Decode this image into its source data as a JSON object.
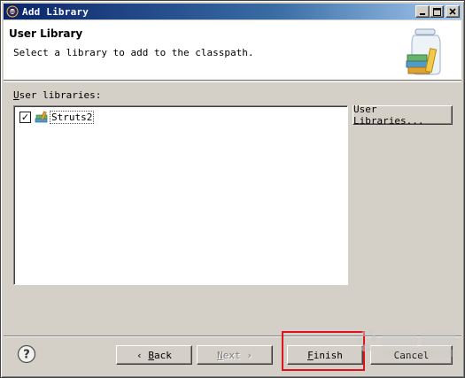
{
  "window": {
    "title": "Add Library",
    "minimize_icon": "minimize-icon",
    "maximize_icon": "maximize-icon",
    "close_icon": "close-icon"
  },
  "header": {
    "title": "User Library",
    "description": "Select a library to add to the classpath.",
    "icon": "library-jar-icon"
  },
  "libraries": {
    "label_first": "U",
    "label_rest": "ser libraries:",
    "items": [
      {
        "label": "Struts2",
        "checked": true,
        "icon": "library-books-icon"
      }
    ],
    "check_glyph": "✓"
  },
  "buttons": {
    "user_libraries": "User Libraries...",
    "back_arrow": "‹",
    "back_first": "B",
    "back_rest": "ack",
    "next_first": "N",
    "next_rest": "ext",
    "next_arrow": "›",
    "finish_first": "F",
    "finish_rest": "inish",
    "cancel": "Cancel"
  },
  "help": {
    "icon": "help-icon",
    "glyph": "?"
  },
  "colors": {
    "highlight": "#e0141e",
    "titlebar_start": "#0a246a",
    "titlebar_end": "#a6caf0"
  }
}
